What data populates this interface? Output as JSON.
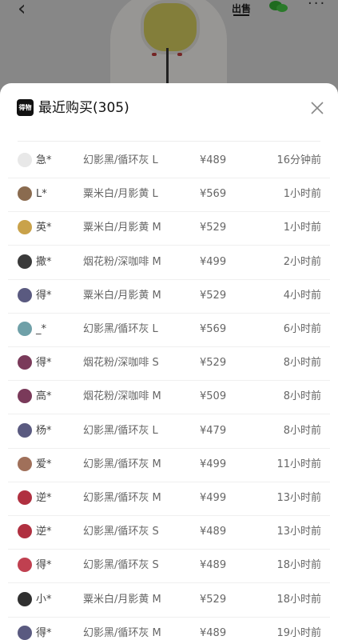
{
  "background": {
    "sell_label": "出售"
  },
  "sheet": {
    "logo_text": "得物",
    "title": "最近购买(305)"
  },
  "rows": [
    {
      "name": "急*",
      "spec": "幻影黑/循环灰 L",
      "price": "¥489",
      "time": "16分钟前",
      "avatar_color": "#e8e8e8"
    },
    {
      "name": "L*",
      "spec": "粟米白/月影黄 L",
      "price": "¥569",
      "time": "1小时前",
      "avatar_color": "#8a6b4f"
    },
    {
      "name": "英*",
      "spec": "粟米白/月影黄 M",
      "price": "¥529",
      "time": "1小时前",
      "avatar_color": "#c9a24a"
    },
    {
      "name": "撒*",
      "spec": "烟花粉/深咖啡 M",
      "price": "¥499",
      "time": "2小时前",
      "avatar_color": "#3a3a3a"
    },
    {
      "name": "得*",
      "spec": "粟米白/月影黄 M",
      "price": "¥529",
      "time": "4小时前",
      "avatar_color": "#5a5a80"
    },
    {
      "name": "_*",
      "spec": "幻影黑/循环灰 L",
      "price": "¥569",
      "time": "6小时前",
      "avatar_color": "#6fa0a8"
    },
    {
      "name": "得*",
      "spec": "烟花粉/深咖啡 S",
      "price": "¥529",
      "time": "8小时前",
      "avatar_color": "#7a3a5a"
    },
    {
      "name": "高*",
      "spec": "烟花粉/深咖啡 M",
      "price": "¥509",
      "time": "8小时前",
      "avatar_color": "#7a3a5a"
    },
    {
      "name": "杨*",
      "spec": "幻影黑/循环灰 L",
      "price": "¥479",
      "time": "8小时前",
      "avatar_color": "#5a5a80"
    },
    {
      "name": "爱*",
      "spec": "幻影黑/循环灰 M",
      "price": "¥499",
      "time": "11小时前",
      "avatar_color": "#a0705a"
    },
    {
      "name": "逆*",
      "spec": "幻影黑/循环灰 M",
      "price": "¥499",
      "time": "13小时前",
      "avatar_color": "#b03040"
    },
    {
      "name": "逆*",
      "spec": "幻影黑/循环灰 S",
      "price": "¥489",
      "time": "13小时前",
      "avatar_color": "#b03040"
    },
    {
      "name": "得*",
      "spec": "幻影黑/循环灰 S",
      "price": "¥489",
      "time": "18小时前",
      "avatar_color": "#c04050"
    },
    {
      "name": "小*",
      "spec": "粟米白/月影黄 M",
      "price": "¥529",
      "time": "18小时前",
      "avatar_color": "#303030"
    },
    {
      "name": "得*",
      "spec": "幻影黑/循环灰 M",
      "price": "¥489",
      "time": "19小时前",
      "avatar_color": "#5a5a80"
    }
  ],
  "icons": {
    "back": "back-arrow-icon",
    "wechat": "wechat-icon",
    "more": "more-icon",
    "close": "close-icon",
    "logo": "dewu-logo"
  }
}
